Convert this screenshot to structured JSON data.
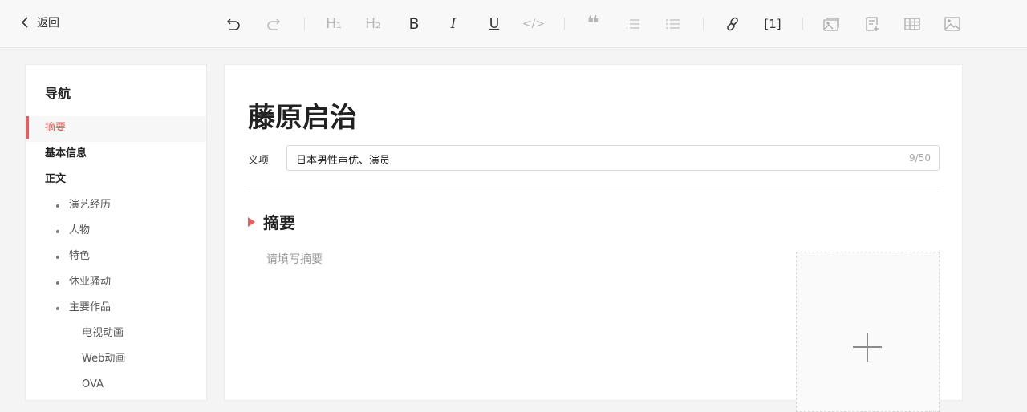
{
  "topbar": {
    "back_label": "返回",
    "toolbar": {
      "h1": "H₁",
      "h2": "H₂",
      "bold": "B",
      "italic": "I",
      "underline": "U",
      "code": "</>",
      "citation": "[1]"
    }
  },
  "sidebar": {
    "title": "导航",
    "items": [
      {
        "label": "摘要",
        "level": 1,
        "active": true
      },
      {
        "label": "基本信息",
        "level": 1
      },
      {
        "label": "正文",
        "level": 1
      },
      {
        "label": "演艺经历",
        "level": 2
      },
      {
        "label": "人物",
        "level": 2
      },
      {
        "label": "特色",
        "level": 2
      },
      {
        "label": "休业骚动",
        "level": 2
      },
      {
        "label": "主要作品",
        "level": 2
      },
      {
        "label": "电视动画",
        "level": 3
      },
      {
        "label": "Web动画",
        "level": 3
      },
      {
        "label": "OVA",
        "level": 3
      }
    ]
  },
  "main": {
    "title": "藤原启治",
    "meaning_label": "义项",
    "meaning_value": "日本男性声优、演员",
    "meaning_count": "9/50",
    "section_title": "摘要",
    "summary_placeholder": "请填写摘要"
  },
  "colors": {
    "accent": "#e4605e"
  }
}
